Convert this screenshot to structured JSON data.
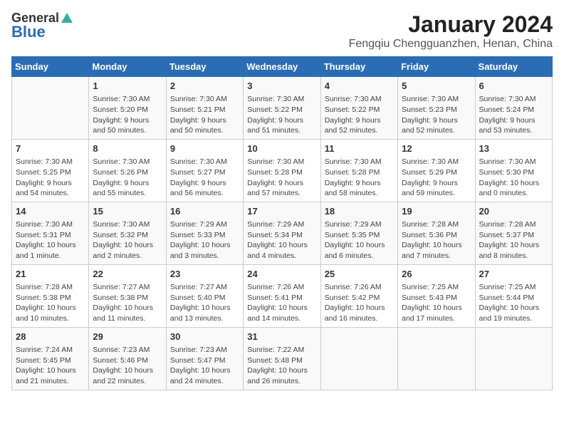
{
  "logo": {
    "general": "General",
    "blue": "Blue"
  },
  "title": "January 2024",
  "subtitle": "Fengqiu Chengguanzhen, Henan, China",
  "days_of_week": [
    "Sunday",
    "Monday",
    "Tuesday",
    "Wednesday",
    "Thursday",
    "Friday",
    "Saturday"
  ],
  "weeks": [
    [
      {
        "day": "",
        "info": ""
      },
      {
        "day": "1",
        "info": "Sunrise: 7:30 AM\nSunset: 5:20 PM\nDaylight: 9 hours\nand 50 minutes."
      },
      {
        "day": "2",
        "info": "Sunrise: 7:30 AM\nSunset: 5:21 PM\nDaylight: 9 hours\nand 50 minutes."
      },
      {
        "day": "3",
        "info": "Sunrise: 7:30 AM\nSunset: 5:22 PM\nDaylight: 9 hours\nand 51 minutes."
      },
      {
        "day": "4",
        "info": "Sunrise: 7:30 AM\nSunset: 5:22 PM\nDaylight: 9 hours\nand 52 minutes."
      },
      {
        "day": "5",
        "info": "Sunrise: 7:30 AM\nSunset: 5:23 PM\nDaylight: 9 hours\nand 52 minutes."
      },
      {
        "day": "6",
        "info": "Sunrise: 7:30 AM\nSunset: 5:24 PM\nDaylight: 9 hours\nand 53 minutes."
      }
    ],
    [
      {
        "day": "7",
        "info": "Sunrise: 7:30 AM\nSunset: 5:25 PM\nDaylight: 9 hours\nand 54 minutes."
      },
      {
        "day": "8",
        "info": "Sunrise: 7:30 AM\nSunset: 5:26 PM\nDaylight: 9 hours\nand 55 minutes."
      },
      {
        "day": "9",
        "info": "Sunrise: 7:30 AM\nSunset: 5:27 PM\nDaylight: 9 hours\nand 56 minutes."
      },
      {
        "day": "10",
        "info": "Sunrise: 7:30 AM\nSunset: 5:28 PM\nDaylight: 9 hours\nand 57 minutes."
      },
      {
        "day": "11",
        "info": "Sunrise: 7:30 AM\nSunset: 5:28 PM\nDaylight: 9 hours\nand 58 minutes."
      },
      {
        "day": "12",
        "info": "Sunrise: 7:30 AM\nSunset: 5:29 PM\nDaylight: 9 hours\nand 59 minutes."
      },
      {
        "day": "13",
        "info": "Sunrise: 7:30 AM\nSunset: 5:30 PM\nDaylight: 10 hours\nand 0 minutes."
      }
    ],
    [
      {
        "day": "14",
        "info": "Sunrise: 7:30 AM\nSunset: 5:31 PM\nDaylight: 10 hours\nand 1 minute."
      },
      {
        "day": "15",
        "info": "Sunrise: 7:30 AM\nSunset: 5:32 PM\nDaylight: 10 hours\nand 2 minutes."
      },
      {
        "day": "16",
        "info": "Sunrise: 7:29 AM\nSunset: 5:33 PM\nDaylight: 10 hours\nand 3 minutes."
      },
      {
        "day": "17",
        "info": "Sunrise: 7:29 AM\nSunset: 5:34 PM\nDaylight: 10 hours\nand 4 minutes."
      },
      {
        "day": "18",
        "info": "Sunrise: 7:29 AM\nSunset: 5:35 PM\nDaylight: 10 hours\nand 6 minutes."
      },
      {
        "day": "19",
        "info": "Sunrise: 7:28 AM\nSunset: 5:36 PM\nDaylight: 10 hours\nand 7 minutes."
      },
      {
        "day": "20",
        "info": "Sunrise: 7:28 AM\nSunset: 5:37 PM\nDaylight: 10 hours\nand 8 minutes."
      }
    ],
    [
      {
        "day": "21",
        "info": "Sunrise: 7:28 AM\nSunset: 5:38 PM\nDaylight: 10 hours\nand 10 minutes."
      },
      {
        "day": "22",
        "info": "Sunrise: 7:27 AM\nSunset: 5:38 PM\nDaylight: 10 hours\nand 11 minutes."
      },
      {
        "day": "23",
        "info": "Sunrise: 7:27 AM\nSunset: 5:40 PM\nDaylight: 10 hours\nand 13 minutes."
      },
      {
        "day": "24",
        "info": "Sunrise: 7:26 AM\nSunset: 5:41 PM\nDaylight: 10 hours\nand 14 minutes."
      },
      {
        "day": "25",
        "info": "Sunrise: 7:26 AM\nSunset: 5:42 PM\nDaylight: 10 hours\nand 16 minutes."
      },
      {
        "day": "26",
        "info": "Sunrise: 7:25 AM\nSunset: 5:43 PM\nDaylight: 10 hours\nand 17 minutes."
      },
      {
        "day": "27",
        "info": "Sunrise: 7:25 AM\nSunset: 5:44 PM\nDaylight: 10 hours\nand 19 minutes."
      }
    ],
    [
      {
        "day": "28",
        "info": "Sunrise: 7:24 AM\nSunset: 5:45 PM\nDaylight: 10 hours\nand 21 minutes."
      },
      {
        "day": "29",
        "info": "Sunrise: 7:23 AM\nSunset: 5:46 PM\nDaylight: 10 hours\nand 22 minutes."
      },
      {
        "day": "30",
        "info": "Sunrise: 7:23 AM\nSunset: 5:47 PM\nDaylight: 10 hours\nand 24 minutes."
      },
      {
        "day": "31",
        "info": "Sunrise: 7:22 AM\nSunset: 5:48 PM\nDaylight: 10 hours\nand 26 minutes."
      },
      {
        "day": "",
        "info": ""
      },
      {
        "day": "",
        "info": ""
      },
      {
        "day": "",
        "info": ""
      }
    ]
  ]
}
